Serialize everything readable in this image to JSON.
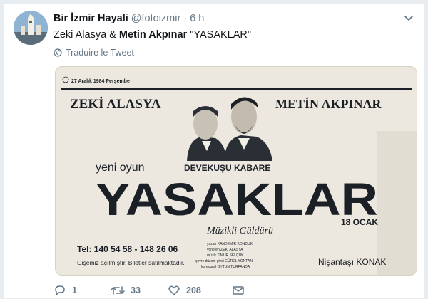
{
  "tweet": {
    "author_name": "Bir İzmir Hayali",
    "author_handle": "@fotoizmir",
    "separator": "·",
    "time": "6 h",
    "text_part1": "Zeki Alasya & ",
    "text_bold": "Metin Akpınar",
    "text_part2": " \"YASAKLAR\"",
    "translate_label": "Traduire le Tweet"
  },
  "poster": {
    "date_line": "27 Aralık 1984 Perşembe",
    "actor_left": "ZEKİ ALASYA",
    "actor_right": "METİN AKPINAR",
    "venue_top": "DEVEKUŞU KABARE",
    "subtitle": "yeni oyun",
    "title": "YASAKLAR",
    "opening_date": "18 OCAK",
    "genre": "Müzikli Güldürü",
    "credits": [
      "yazan KANDEMİR KONDUK",
      "yöneten ZEKİ ALASYA",
      "müzik TİMUR SELÇUK",
      "çevre düzeni giysi GÜREL YONTAN",
      "koreograf OYTUN TURFANDA"
    ],
    "phone": "Tel: 140 54 58 - 148 26 06",
    "notice": "Gişemiz açılmıştır. Biletler satılmaktadır.",
    "location": "Nişantaşı KONAK"
  },
  "actions": {
    "reply_count": "1",
    "retweet_count": "33",
    "like_count": "208"
  },
  "colors": {
    "accent": "#1da1f2",
    "muted": "#657786",
    "poster_ink": "#1b1f26",
    "poster_paper": "#ece8df"
  }
}
